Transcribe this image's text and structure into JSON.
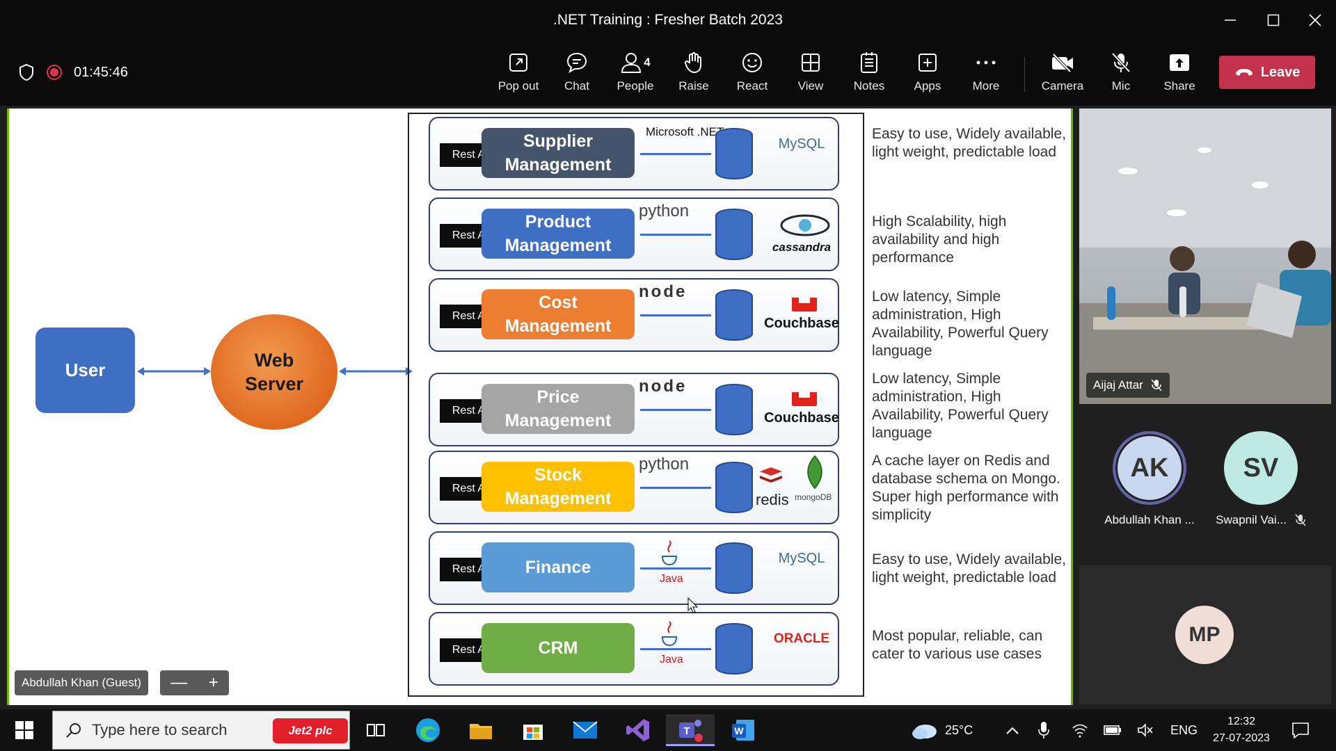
{
  "window": {
    "title": ".NET Training : Fresher Batch 2023"
  },
  "meeting": {
    "timer": "01:45:46"
  },
  "toolbar": {
    "pop_out": "Pop out",
    "chat": "Chat",
    "people": "People",
    "people_count": "4",
    "raise": "Raise",
    "react": "React",
    "view": "View",
    "notes": "Notes",
    "apps": "Apps",
    "more": "More",
    "camera": "Camera",
    "mic": "Mic",
    "share": "Share",
    "leave": "Leave"
  },
  "slide": {
    "user": "User",
    "web_server_line1": "Web",
    "web_server_line2": "Server",
    "rest_api": "Rest API",
    "services": [
      {
        "name1": "Supplier",
        "name2": "Management",
        "color": "#44546a",
        "tech": "Microsoft .NET",
        "db": "MySQL",
        "desc": "Easy to use, Widely available, light weight, predictable load"
      },
      {
        "name1": "Product",
        "name2": "Management",
        "color": "#3e6fc4",
        "tech": "python",
        "db": "cassandra",
        "desc": "High Scalability, high availability and high performance"
      },
      {
        "name1": "Cost",
        "name2": "Management",
        "color": "#ed7d31",
        "tech": "node",
        "db": "Couchbase",
        "desc": "Low latency, Simple administration, High Availability, Powerful Query language"
      },
      {
        "name1": "Price",
        "name2": "Management",
        "color": "#a5a5a5",
        "tech": "node",
        "db": "Couchbase",
        "desc": "Low latency, Simple administration, High Availability, Powerful Query language"
      },
      {
        "name1": "Stock",
        "name2": "Management",
        "color": "#ffc000",
        "tech": "python",
        "db": "redis",
        "db2": "mongoDB",
        "desc": "A cache layer on Redis and database schema on Mongo. Super high performance with simplicity"
      },
      {
        "name1": "Finance",
        "name2": "",
        "color": "#5b9bd5",
        "tech": "Java",
        "db": "MySQL",
        "desc": "Easy to use, Widely available, light weight, predictable load"
      },
      {
        "name1": "CRM",
        "name2": "",
        "color": "#70ad47",
        "tech": "Java",
        "db": "ORACLE",
        "desc": "Most popular, reliable, can cater to various use cases"
      }
    ]
  },
  "stage": {
    "presenter": "Abdullah Khan (Guest)",
    "zoom_out": "—",
    "zoom_in": "+"
  },
  "participants": {
    "video_name": "Aijaj Attar",
    "p1_initials": "AK",
    "p1_name": "Abdullah Khan ...",
    "p2_initials": "SV",
    "p2_name": "Swapnil Vai...",
    "p3_initials": "MP"
  },
  "taskbar": {
    "search_placeholder": "Type here to search",
    "promo": "Jet2 plc",
    "weather": "25°C",
    "lang": "ENG",
    "time": "12:32",
    "date": "27-07-2023"
  }
}
